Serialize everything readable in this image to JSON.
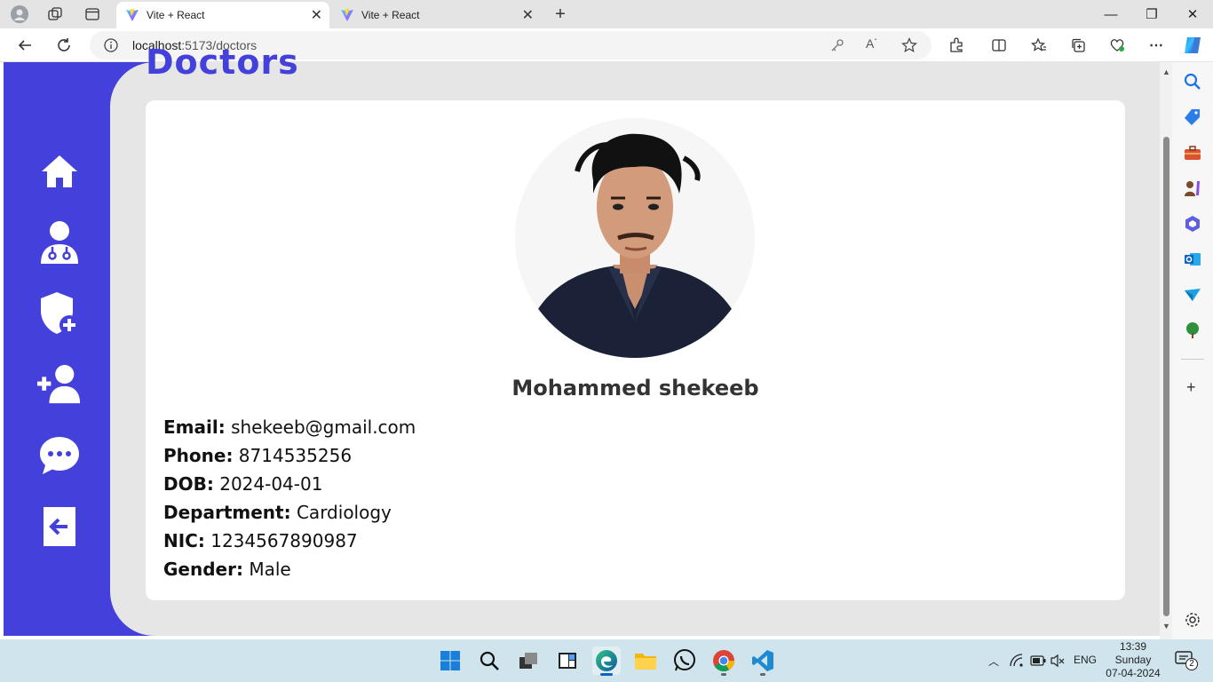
{
  "browser": {
    "tabs": [
      {
        "title": "Vite + React",
        "active": true
      },
      {
        "title": "Vite + React",
        "active": false
      }
    ],
    "address": {
      "host": "localhost",
      "path": ":5173/doctors"
    }
  },
  "page": {
    "title": "Doctors",
    "sidebar": [
      "home-icon",
      "doctor-icon",
      "shield-plus-icon",
      "add-user-icon",
      "message-icon",
      "logout-icon"
    ],
    "doctor": {
      "name": "Mohammed shekeeb",
      "fields": [
        {
          "label": "Email:",
          "value": "shekeeb@gmail.com"
        },
        {
          "label": "Phone:",
          "value": "8714535256"
        },
        {
          "label": "DOB:",
          "value": "2024-04-01"
        },
        {
          "label": "Department:",
          "value": "Cardiology"
        },
        {
          "label": "NIC:",
          "value": "1234567890987"
        },
        {
          "label": "Gender:",
          "value": "Male"
        }
      ]
    }
  },
  "taskbar": {
    "time": "13:39",
    "day": "Sunday",
    "date": "07-04-2024",
    "lang": "ENG",
    "notifications": "2"
  },
  "colors": {
    "brand": "#4440db",
    "content_bg": "#e6e6e6"
  }
}
